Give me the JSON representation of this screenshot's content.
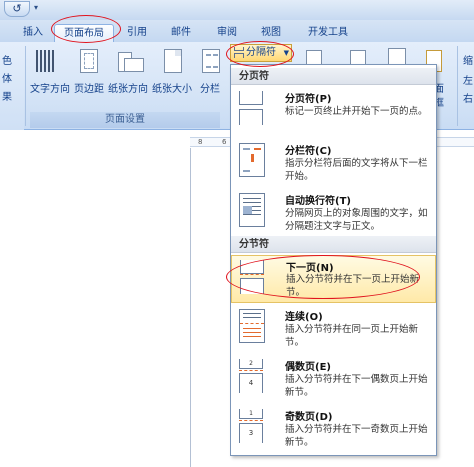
{
  "tabs": {
    "insert": "插入",
    "layout": "页面布局",
    "references": "引用",
    "mailings": "邮件",
    "review": "审阅",
    "view": "视图",
    "developer": "开发工具"
  },
  "ribbon": {
    "side_left_1": "色",
    "side_left_2": "体",
    "side_left_3": "果",
    "text_direction": "文字方向",
    "margins": "页边距",
    "orientation": "纸张方向",
    "size": "纸张大小",
    "columns": "分栏",
    "group_label": "页面设置",
    "breaks_button": "分隔符",
    "right_label_1": "页面",
    "right_label_2": "边框",
    "right_side_1": "缩",
    "right_side_2": "左",
    "right_side_3": "右"
  },
  "ruler": {
    "tick1": "8",
    "tick2": "6",
    "tick3": "4"
  },
  "menu": {
    "section_page_breaks": "分页符",
    "section_section_breaks": "分节符",
    "items": [
      {
        "icon": "page-break-icon",
        "title": "分页符(P)",
        "desc": "标记一页终止并开始下一页的点。"
      },
      {
        "icon": "column-break-icon",
        "title": "分栏符(C)",
        "desc": "指示分栏符后面的文字将从下一栏开始。"
      },
      {
        "icon": "text-wrapping-break-icon",
        "title": "自动换行符(T)",
        "desc": "分隔网页上的对象周围的文字，如分隔题注文字与正文。"
      },
      {
        "icon": "next-page-break-icon",
        "title": "下一页(N)",
        "desc": "插入分节符并在下一页上开始新节。"
      },
      {
        "icon": "continuous-break-icon",
        "title": "连续(O)",
        "desc": "插入分节符并在同一页上开始新节。"
      },
      {
        "icon": "even-page-break-icon",
        "title": "偶数页(E)",
        "desc": "插入分节符并在下一偶数页上开始新节。"
      },
      {
        "icon": "odd-page-break-icon",
        "title": "奇数页(D)",
        "desc": "插入分节符并在下一奇数页上开始新节。"
      }
    ]
  },
  "colors": {
    "annotation": "#e0141e",
    "ribbon": "#d5e4f6",
    "highlight": "#ffe9a8"
  }
}
